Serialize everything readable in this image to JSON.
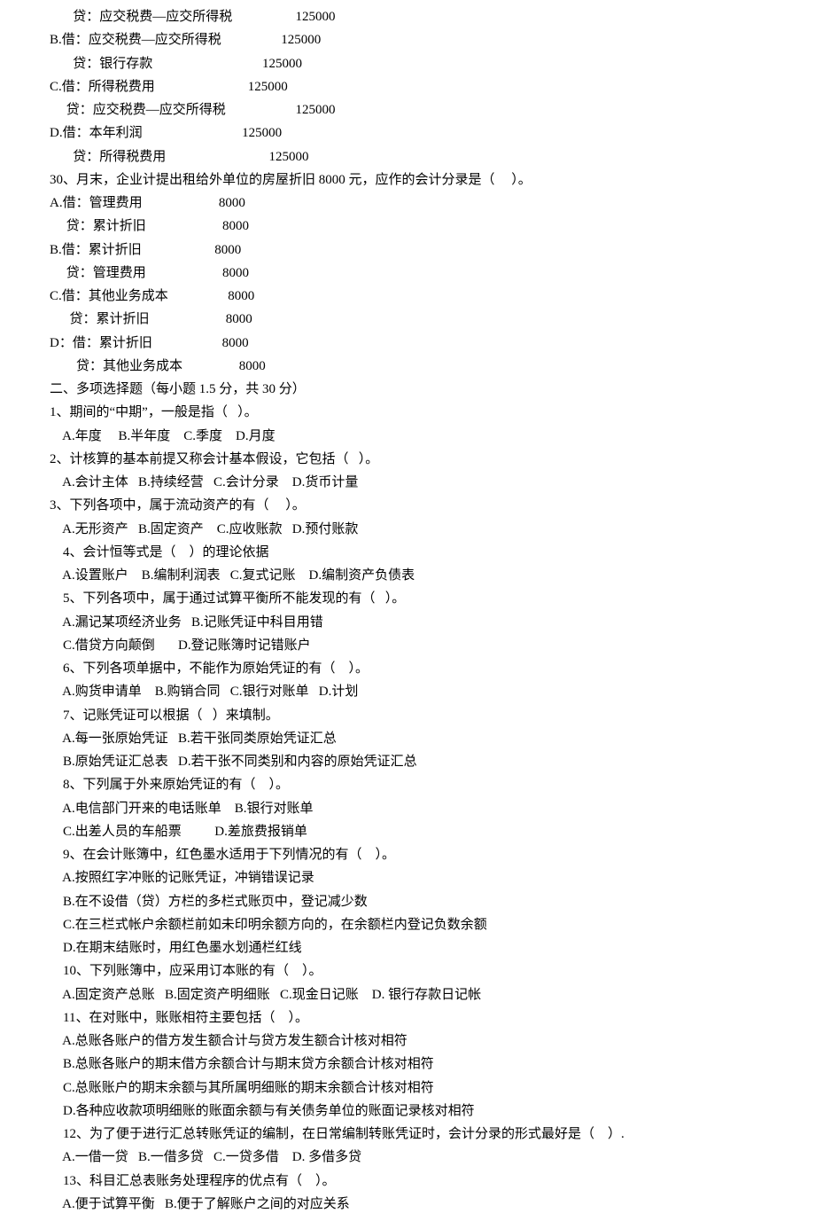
{
  "lines": [
    "       贷：应交税费—应交所得税                   125000",
    "B.借：应交税费—应交所得税                  125000",
    "       贷：银行存款                                 125000",
    "C.借：所得税费用                            125000",
    "     贷：应交税费—应交所得税                     125000",
    "D.借：本年利润                              125000",
    "       贷：所得税费用                               125000",
    "30、月末，企业计提出租给外单位的房屋折旧 8000 元，应作的会计分录是（     ）。",
    "A.借：管理费用                       8000",
    "     贷：累计折旧                       8000",
    "B.借：累计折旧                      8000",
    "     贷：管理费用                       8000",
    "C.借：其他业务成本                  8000",
    "      贷：累计折旧                       8000",
    "D：借：累计折旧                     8000",
    "        贷：其他业务成本                 8000",
    "二、多项选择题（每小题 1.5 分，共 30 分）",
    "1、期间的“中期”，一般是指（   ）。",
    "    A.年度     B.半年度    C.季度    D.月度",
    "2、计核算的基本前提又称会计基本假设，它包括（   ）。",
    "    A.会计主体   B.持续经营   C.会计分录    D.货币计量",
    "3、下列各项中，属于流动资产的有（     ）。",
    "    A.无形资产   B.固定资产    C.应收账款   D.预付账款",
    "    4、会计恒等式是（    ）的理论依据",
    "    A.设置账户    B.编制利润表   C.复式记账    D.编制资产负债表",
    "    5、下列各项中，属于通过试算平衡所不能发现的有（   ）。",
    "    A.漏记某项经济业务   B.记账凭证中科目用错",
    "    C.借贷方向颠倒       D.登记账簿时记错账户",
    "    6、下列各项单据中，不能作为原始凭证的有（    ）。",
    "    A.购货申请单    B.购销合同   C.银行对账单   D.计划",
    "    7、记账凭证可以根据（   ）来填制。",
    "    A.每一张原始凭证   B.若干张同类原始凭证汇总",
    "    B.原始凭证汇总表   D.若干张不同类别和内容的原始凭证汇总",
    "    8、下列属于外来原始凭证的有（    ）。",
    "    A.电信部门开来的电话账单    B.银行对账单",
    "    C.出差人员的车船票          D.差旅费报销单",
    "    9、在会计账簿中，红色墨水适用于下列情况的有（    ）。",
    "    A.按照红字冲账的记账凭证，冲销错误记录",
    "    B.在不设借（贷）方栏的多栏式账页中，登记减少数",
    "    C.在三栏式帐户余额栏前如未印明余额方向的，在余额栏内登记负数余额",
    "    D.在期末结账时，用红色墨水划通栏红线",
    "    10、下列账簿中，应采用订本账的有（    ）。",
    "    A.固定资产总账   B.固定资产明细账   C.现金日记账    D. 银行存款日记帐",
    "    11、在对账中，账账相符主要包括（    ）。",
    "    A.总账各账户的借方发生额合计与贷方发生额合计核对相符",
    "    B.总账各账户的期末借方余额合计与期末贷方余额合计核对相符",
    "    C.总账账户的期末余额与其所属明细账的期末余额合计核对相符",
    "    D.各种应收款项明细账的账面余额与有关债务单位的账面记录核对相符",
    "    12、为了便于进行汇总转账凭证的编制，在日常编制转账凭证时，会计分录的形式最好是（    ）.",
    "    A.一借一贷   B.一借多贷   C.一贷多借    D. 多借多贷",
    "    13、科目汇总表账务处理程序的优点有（    ）。",
    "    A.便于试算平衡   B.便于了解账户之间的对应关系"
  ]
}
